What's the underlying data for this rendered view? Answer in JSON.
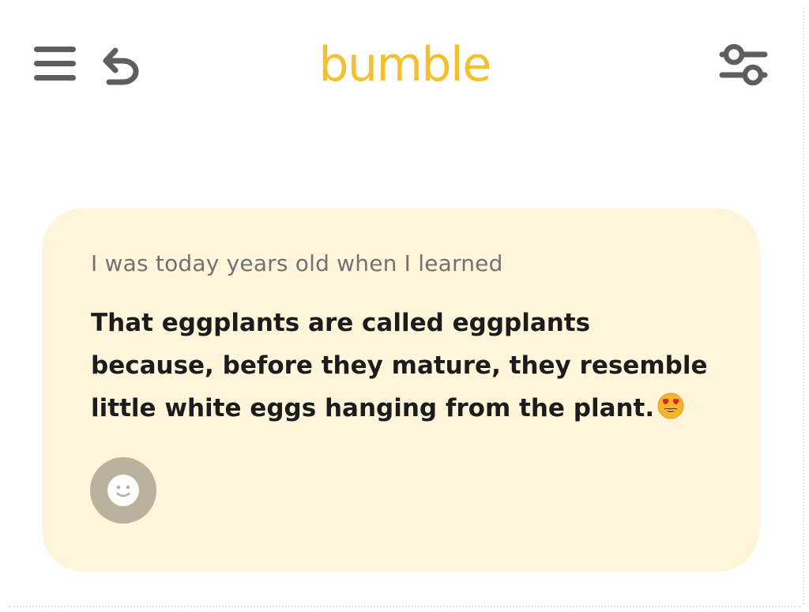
{
  "app": {
    "brand": "bumble",
    "brand_color": "#f5c02f",
    "icon_color": "#5e5e5e"
  },
  "header": {
    "left_icons": [
      "menu-icon",
      "undo-icon"
    ],
    "right_icons": [
      "filter-sliders-icon"
    ]
  },
  "prompt_card": {
    "background_color": "#fff5db",
    "question": "I was today years old when I learned",
    "answer": "That eggplants are called eggplants because, before they mature, they resemble little white eggs hanging from the plant.",
    "answer_emoji_icon": "heart-eyes-emoji-icon",
    "reaction_button_icon": "smiley-face-icon"
  }
}
